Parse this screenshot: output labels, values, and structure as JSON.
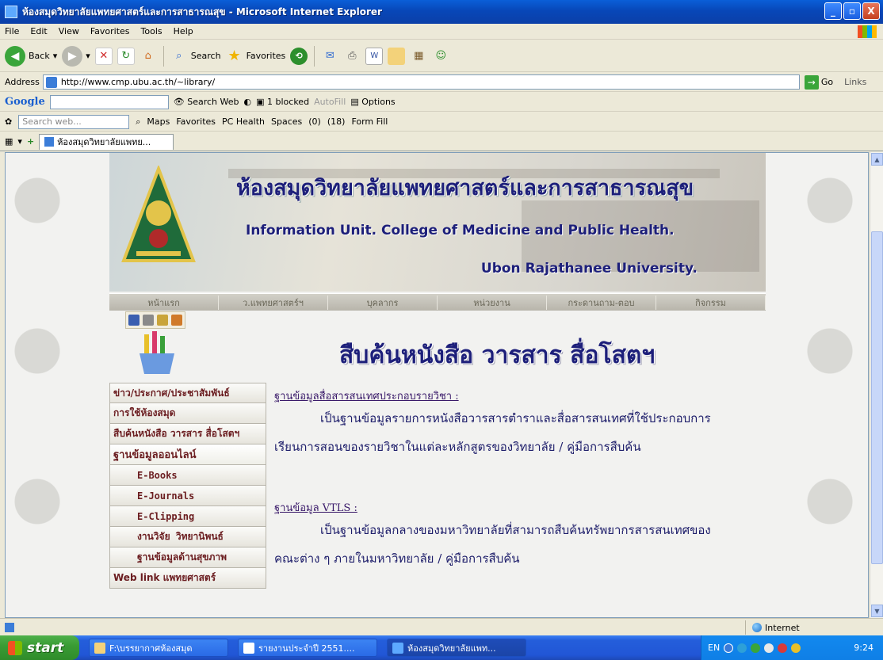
{
  "window": {
    "title": "ห้องสมุดวิทยาลัยแพทยศาสตร์และการสาธารณสุข - Microsoft Internet Explorer",
    "min_label": "_",
    "max_label": "▫",
    "close_label": "X"
  },
  "menu": [
    "File",
    "Edit",
    "View",
    "Favorites",
    "Tools",
    "Help"
  ],
  "toolbar": {
    "back_label": "Back",
    "search_label": "Search",
    "favorites_label": "Favorites"
  },
  "address": {
    "label": "Address",
    "url": "http://www.cmp.ubu.ac.th/~library/",
    "go_label": "Go",
    "links_label": "Links"
  },
  "google_bar": {
    "logo": "Google",
    "search_web": "Search Web",
    "blocked": "1 blocked",
    "autofill": "AutoFill",
    "options": "Options"
  },
  "msn_bar": {
    "search_placeholder": "Search web...",
    "maps": "Maps",
    "favorites": "Favorites",
    "pc_health": "PC Health",
    "spaces": "Spaces",
    "mail_count": "(0)",
    "messenger_count": "(18)",
    "form_fill": "Form Fill"
  },
  "tab": {
    "title": "ห้องสมุดวิทยาลัยแพทย..."
  },
  "page": {
    "banner_th": "ห้องสมุดวิทยาลัยแพทยศาสตร์และการสาธารณสุข",
    "banner_en1": "Information Unit. College of Medicine and Public Health.",
    "banner_en2": "Ubon Rajathanee University.",
    "nav": [
      "หน้าแรก",
      "ว.แพทยศาสตร์ฯ",
      "บุคลากร",
      "หน่วยงาน",
      "กระดานถาม-ตอบ",
      "กิจกรรม"
    ],
    "section_title": "สืบค้นหนังสือ วารสาร สื่อโสตฯ",
    "sidebar": [
      {
        "label": "ข่าว/ประกาศ/ประชาสัมพันธ์",
        "type": "item"
      },
      {
        "label": "การใช้ห้องสมุด",
        "type": "item"
      },
      {
        "label": "สืบค้นหนังสือ วารสาร สื่อโสตฯ",
        "type": "item"
      },
      {
        "label": "ฐานข้อมูลออนไลน์",
        "type": "header"
      },
      {
        "label": "E-Books",
        "type": "sub"
      },
      {
        "label": "E-Journals",
        "type": "sub"
      },
      {
        "label": "E-Clipping",
        "type": "sub"
      },
      {
        "label": "งานวิจัย วิทยานิพนธ์",
        "type": "sub"
      },
      {
        "label": "ฐานข้อมูลด้านสุขภาพ",
        "type": "sub"
      },
      {
        "label": "Web link แพทยศาสตร์",
        "type": "item"
      }
    ],
    "db1_title": "ฐานข้อมูลสื่อสารสนเทศประกอบรายวิชา :",
    "db1_line1": "เป็นฐานข้อมูลรายการหนังสือวารสารตำราและสื่อสารสนเทศที่ใช้ประกอบการ",
    "db1_line2": "เรียนการสอนของรายวิชาในแต่ละหลักสูตรของวิทยาลัย / คู่มือการสืบค้น",
    "db2_title": "ฐานข้อมูล VTLS :",
    "db2_line1": "เป็นฐานข้อมูลกลางของมหาวิทยาลัยที่สามารถสืบค้นทรัพยากรสารสนเทศของ",
    "db2_line2": "คณะต่าง ๆ ภายในมหาวิทยาลัย / คู่มือการสืบค้น"
  },
  "status": {
    "zone": "Internet"
  },
  "taskbar": {
    "start": "start",
    "tasks": [
      "F:\\บรรยากาศห้องสมุด",
      "รายงานประจำปี 2551....",
      "ห้องสมุดวิทยาลัยแพท..."
    ],
    "lang": "EN",
    "clock": "9:24"
  },
  "colors": {
    "title_navy": "#1d1f7a",
    "menu_maroon": "#6b1d20",
    "xp_blue": "#245edb",
    "start_green": "#3a9c35"
  }
}
